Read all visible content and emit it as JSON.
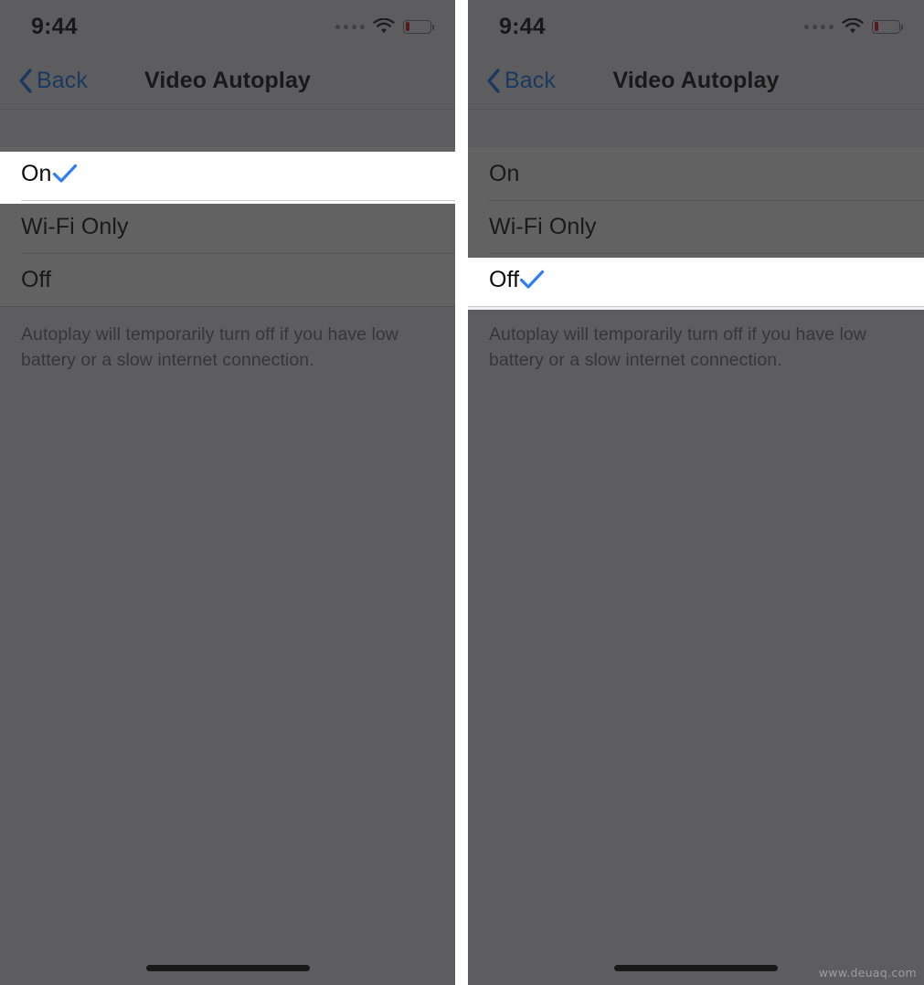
{
  "page": {
    "watermark": "www.deuaq.com",
    "accent_blue": "#2f7cf6",
    "back_link_blue": "#1277f2",
    "dim_overlay": "rgba(32,32,32,0.70)",
    "highlight_background": "#ffffff",
    "battery_color": "#d80f1b"
  },
  "panels": [
    {
      "status": {
        "time": "9:44",
        "signal_icon": "signal-dots-icon",
        "wifi_icon": "wifi-icon",
        "battery_icon": "battery-low-icon",
        "battery_level_percent": 17
      },
      "nav": {
        "back_icon": "chevron-left-icon",
        "back_label": "Back",
        "title": "Video Autoplay"
      },
      "options": [
        {
          "label": "On",
          "selected": true,
          "check_icon": "checkmark-icon"
        },
        {
          "label": "Wi-Fi Only",
          "selected": false,
          "check_icon": "checkmark-icon"
        },
        {
          "label": "Off",
          "selected": false,
          "check_icon": "checkmark-icon"
        }
      ],
      "footer_note": "Autoplay will temporarily turn off if you have low battery or a slow internet connection.",
      "home_indicator": "home-indicator"
    },
    {
      "status": {
        "time": "9:44",
        "signal_icon": "signal-dots-icon",
        "wifi_icon": "wifi-icon",
        "battery_icon": "battery-low-icon",
        "battery_level_percent": 17
      },
      "nav": {
        "back_icon": "chevron-left-icon",
        "back_label": "Back",
        "title": "Video Autoplay"
      },
      "options": [
        {
          "label": "On",
          "selected": false,
          "check_icon": "checkmark-icon"
        },
        {
          "label": "Wi-Fi Only",
          "selected": false,
          "check_icon": "checkmark-icon"
        },
        {
          "label": "Off",
          "selected": true,
          "check_icon": "checkmark-icon"
        }
      ],
      "footer_note": "Autoplay will temporarily turn off if you have low battery or a slow internet connection.",
      "home_indicator": "home-indicator"
    }
  ]
}
